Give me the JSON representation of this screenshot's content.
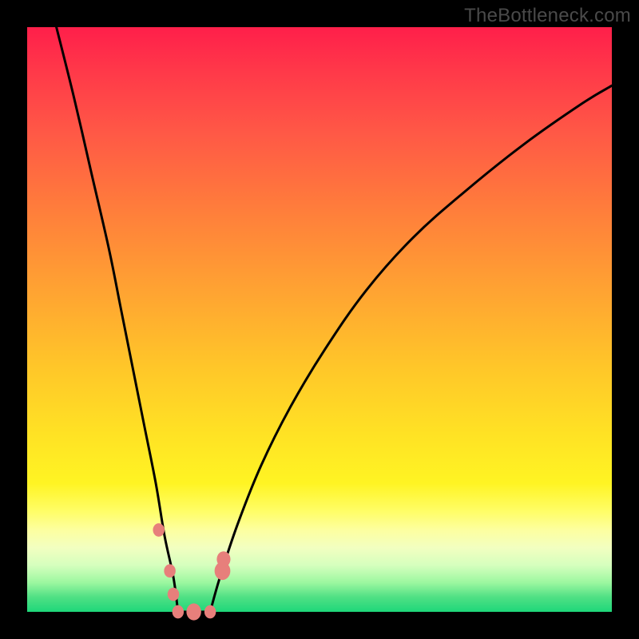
{
  "watermark": "TheBottleneck.com",
  "colors": {
    "frame": "#000000",
    "curve": "#000000",
    "marker": "#e77f7b",
    "gradient_top": "#ff1f4a",
    "gradient_bottom": "#1ed77a"
  },
  "chart_data": {
    "type": "line",
    "title": "",
    "xlabel": "",
    "ylabel": "",
    "xlim": [
      0,
      100
    ],
    "ylim": [
      0,
      100
    ],
    "grid": false,
    "legend": false,
    "note": "Bottleneck-style V curve. No axis ticks or labels are rendered. x is a nominal 0–100 horizontal scale, y is bottleneck percentage (0 = best, at bottom).",
    "series": [
      {
        "name": "left-branch",
        "x": [
          5,
          8,
          11,
          14,
          16,
          18,
          20,
          22,
          23.5,
          25,
          25.8
        ],
        "y": [
          100,
          88,
          75,
          62,
          52,
          42,
          32,
          22,
          13,
          6,
          0
        ]
      },
      {
        "name": "floor",
        "x": [
          25.8,
          27,
          28.5,
          30,
          31.3
        ],
        "y": [
          0,
          0,
          0,
          0,
          0
        ]
      },
      {
        "name": "right-branch",
        "x": [
          31.3,
          33,
          36,
          40,
          45,
          51,
          58,
          66,
          75,
          85,
          95,
          100
        ],
        "y": [
          0,
          6,
          15,
          25,
          35,
          45,
          55,
          64,
          72,
          80,
          87,
          90
        ]
      }
    ],
    "markers": [
      {
        "x": 22.5,
        "y": 14,
        "r": 1.1
      },
      {
        "x": 24.4,
        "y": 7,
        "r": 1.1
      },
      {
        "x": 25.0,
        "y": 3,
        "r": 1.1
      },
      {
        "x": 25.8,
        "y": 0,
        "r": 1.1
      },
      {
        "x": 28.5,
        "y": 0,
        "r": 1.4
      },
      {
        "x": 31.3,
        "y": 0,
        "r": 1.1
      },
      {
        "x": 33.4,
        "y": 7,
        "r": 1.5
      },
      {
        "x": 33.6,
        "y": 9,
        "r": 1.3
      }
    ]
  }
}
